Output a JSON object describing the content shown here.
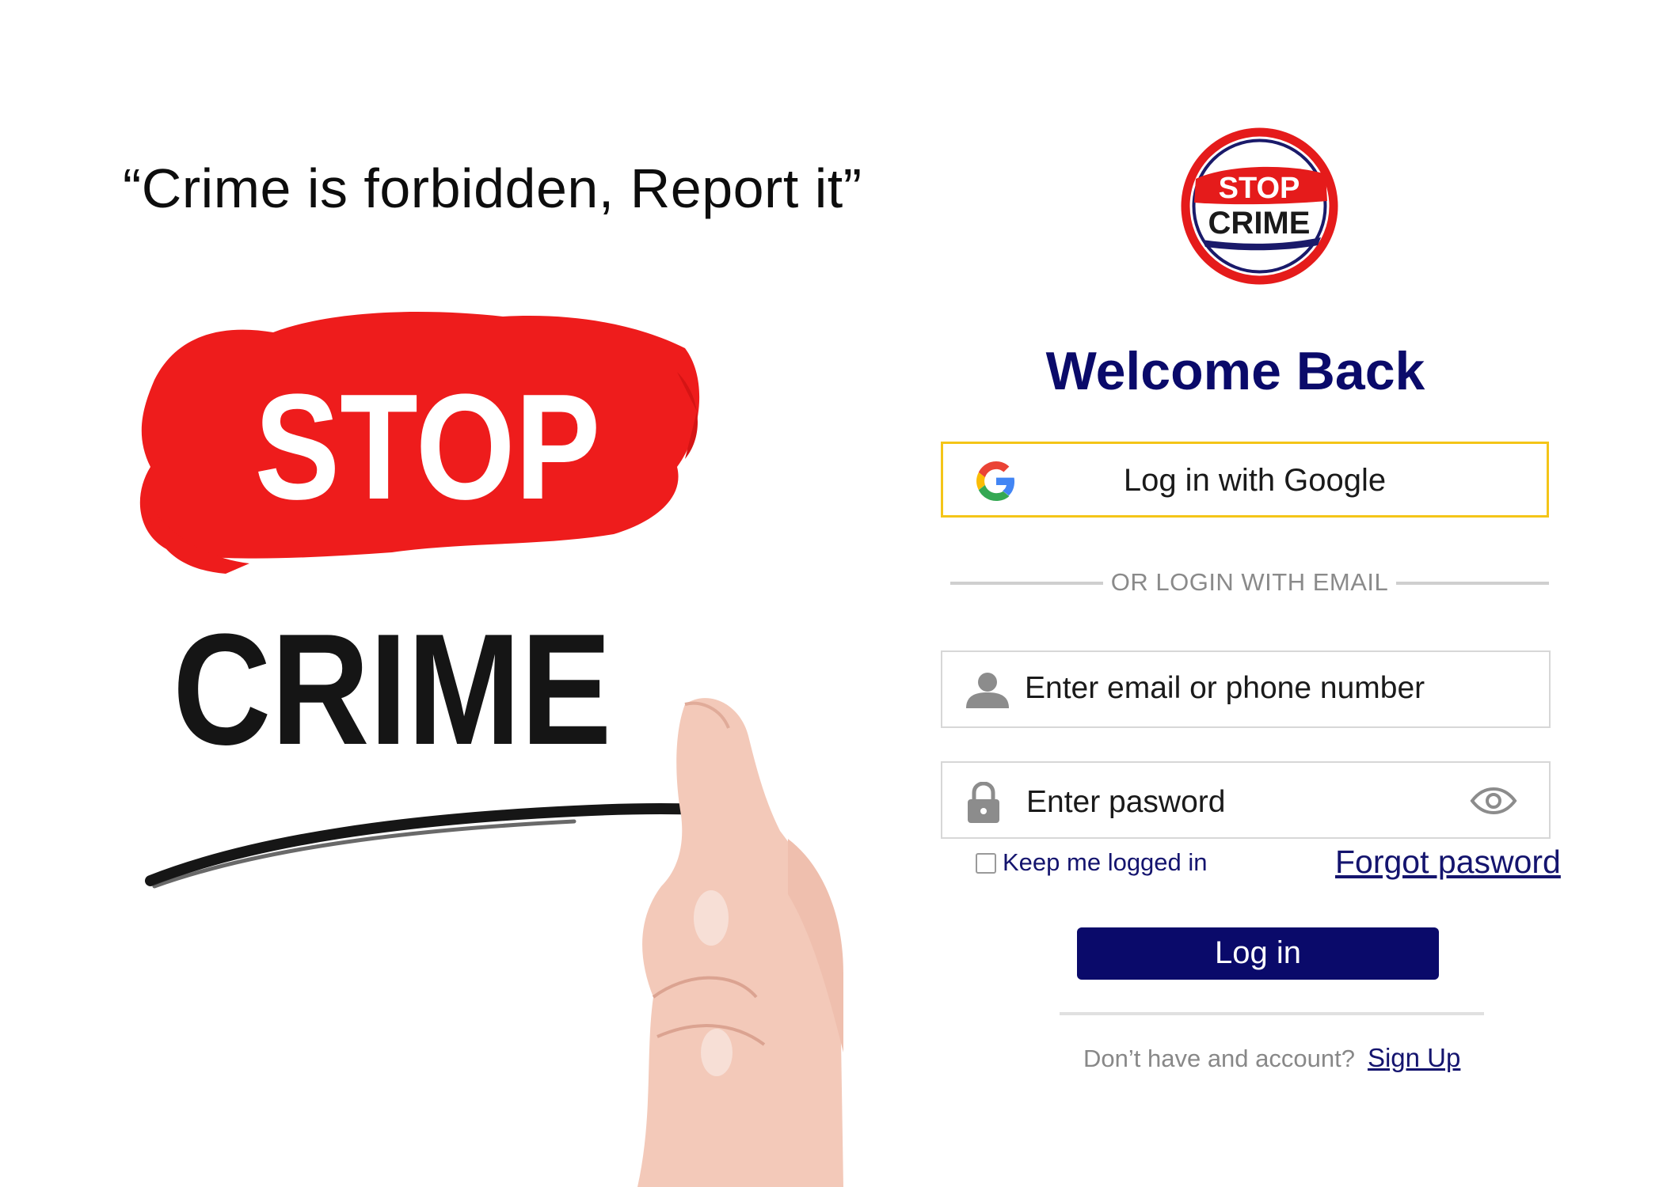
{
  "hero": {
    "slogan": "“Crime is forbidden, Report it”",
    "image_text_top": "STOP",
    "image_text_bottom": "CRIME"
  },
  "logo": {
    "text_top": "STOP",
    "text_bottom": "CRIME"
  },
  "login": {
    "title": "Welcome Back",
    "google_label": "Log in with Google",
    "divider_text": "OR LOGIN WITH EMAIL",
    "email_placeholder": "Enter email or phone number",
    "password_placeholder": "Enter pasword",
    "keep_logged_in_label": "Keep me logged in",
    "keep_logged_in_checked": false,
    "forgot_label": "Forgot pasword",
    "submit_label": "Log in",
    "signup_question": "Don’t have and account?",
    "signup_link": "Sign Up"
  },
  "icons": {
    "google": "google-g-icon",
    "user": "user-icon",
    "lock": "lock-icon",
    "eye": "eye-icon"
  },
  "colors": {
    "brand_navy": "#0a0a6a",
    "brand_red": "#e51b1b",
    "google_border": "#f4c518"
  }
}
